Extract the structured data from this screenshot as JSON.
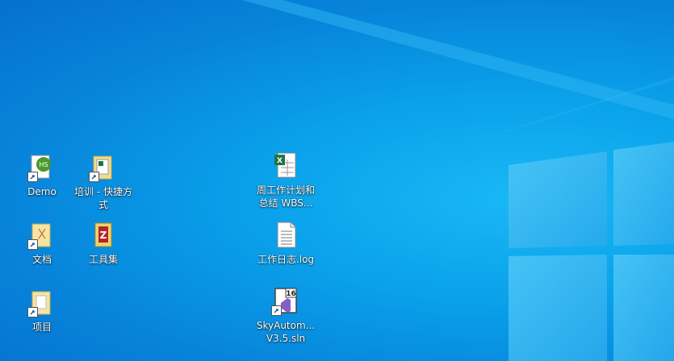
{
  "desktop": {
    "icons": [
      {
        "label": "Demo",
        "icon": "vs-project-shortcut-icon",
        "shortcut": true
      },
      {
        "label": "培训 - 快捷方式",
        "icon": "excel-folder-shortcut-icon",
        "shortcut": true
      },
      {
        "label": "周工作计划和总结  WBS...",
        "icon": "excel-file-icon",
        "shortcut": false
      },
      {
        "label": "文档",
        "icon": "folder-shortcut-icon",
        "shortcut": true
      },
      {
        "label": "工具集",
        "icon": "winrar-archive-icon",
        "shortcut": false
      },
      {
        "label": "工作日志.log",
        "icon": "text-file-icon",
        "shortcut": false
      },
      {
        "label": "项目",
        "icon": "folder-shortcut-icon",
        "shortcut": true
      },
      {
        "label": "SkyAutom... V3.5.sln",
        "icon": "vs-solution-icon",
        "shortcut": true
      }
    ]
  },
  "colors": {
    "background": "#0784da",
    "logo_pane": "#33b6f2",
    "label_text": "#ffffff"
  }
}
